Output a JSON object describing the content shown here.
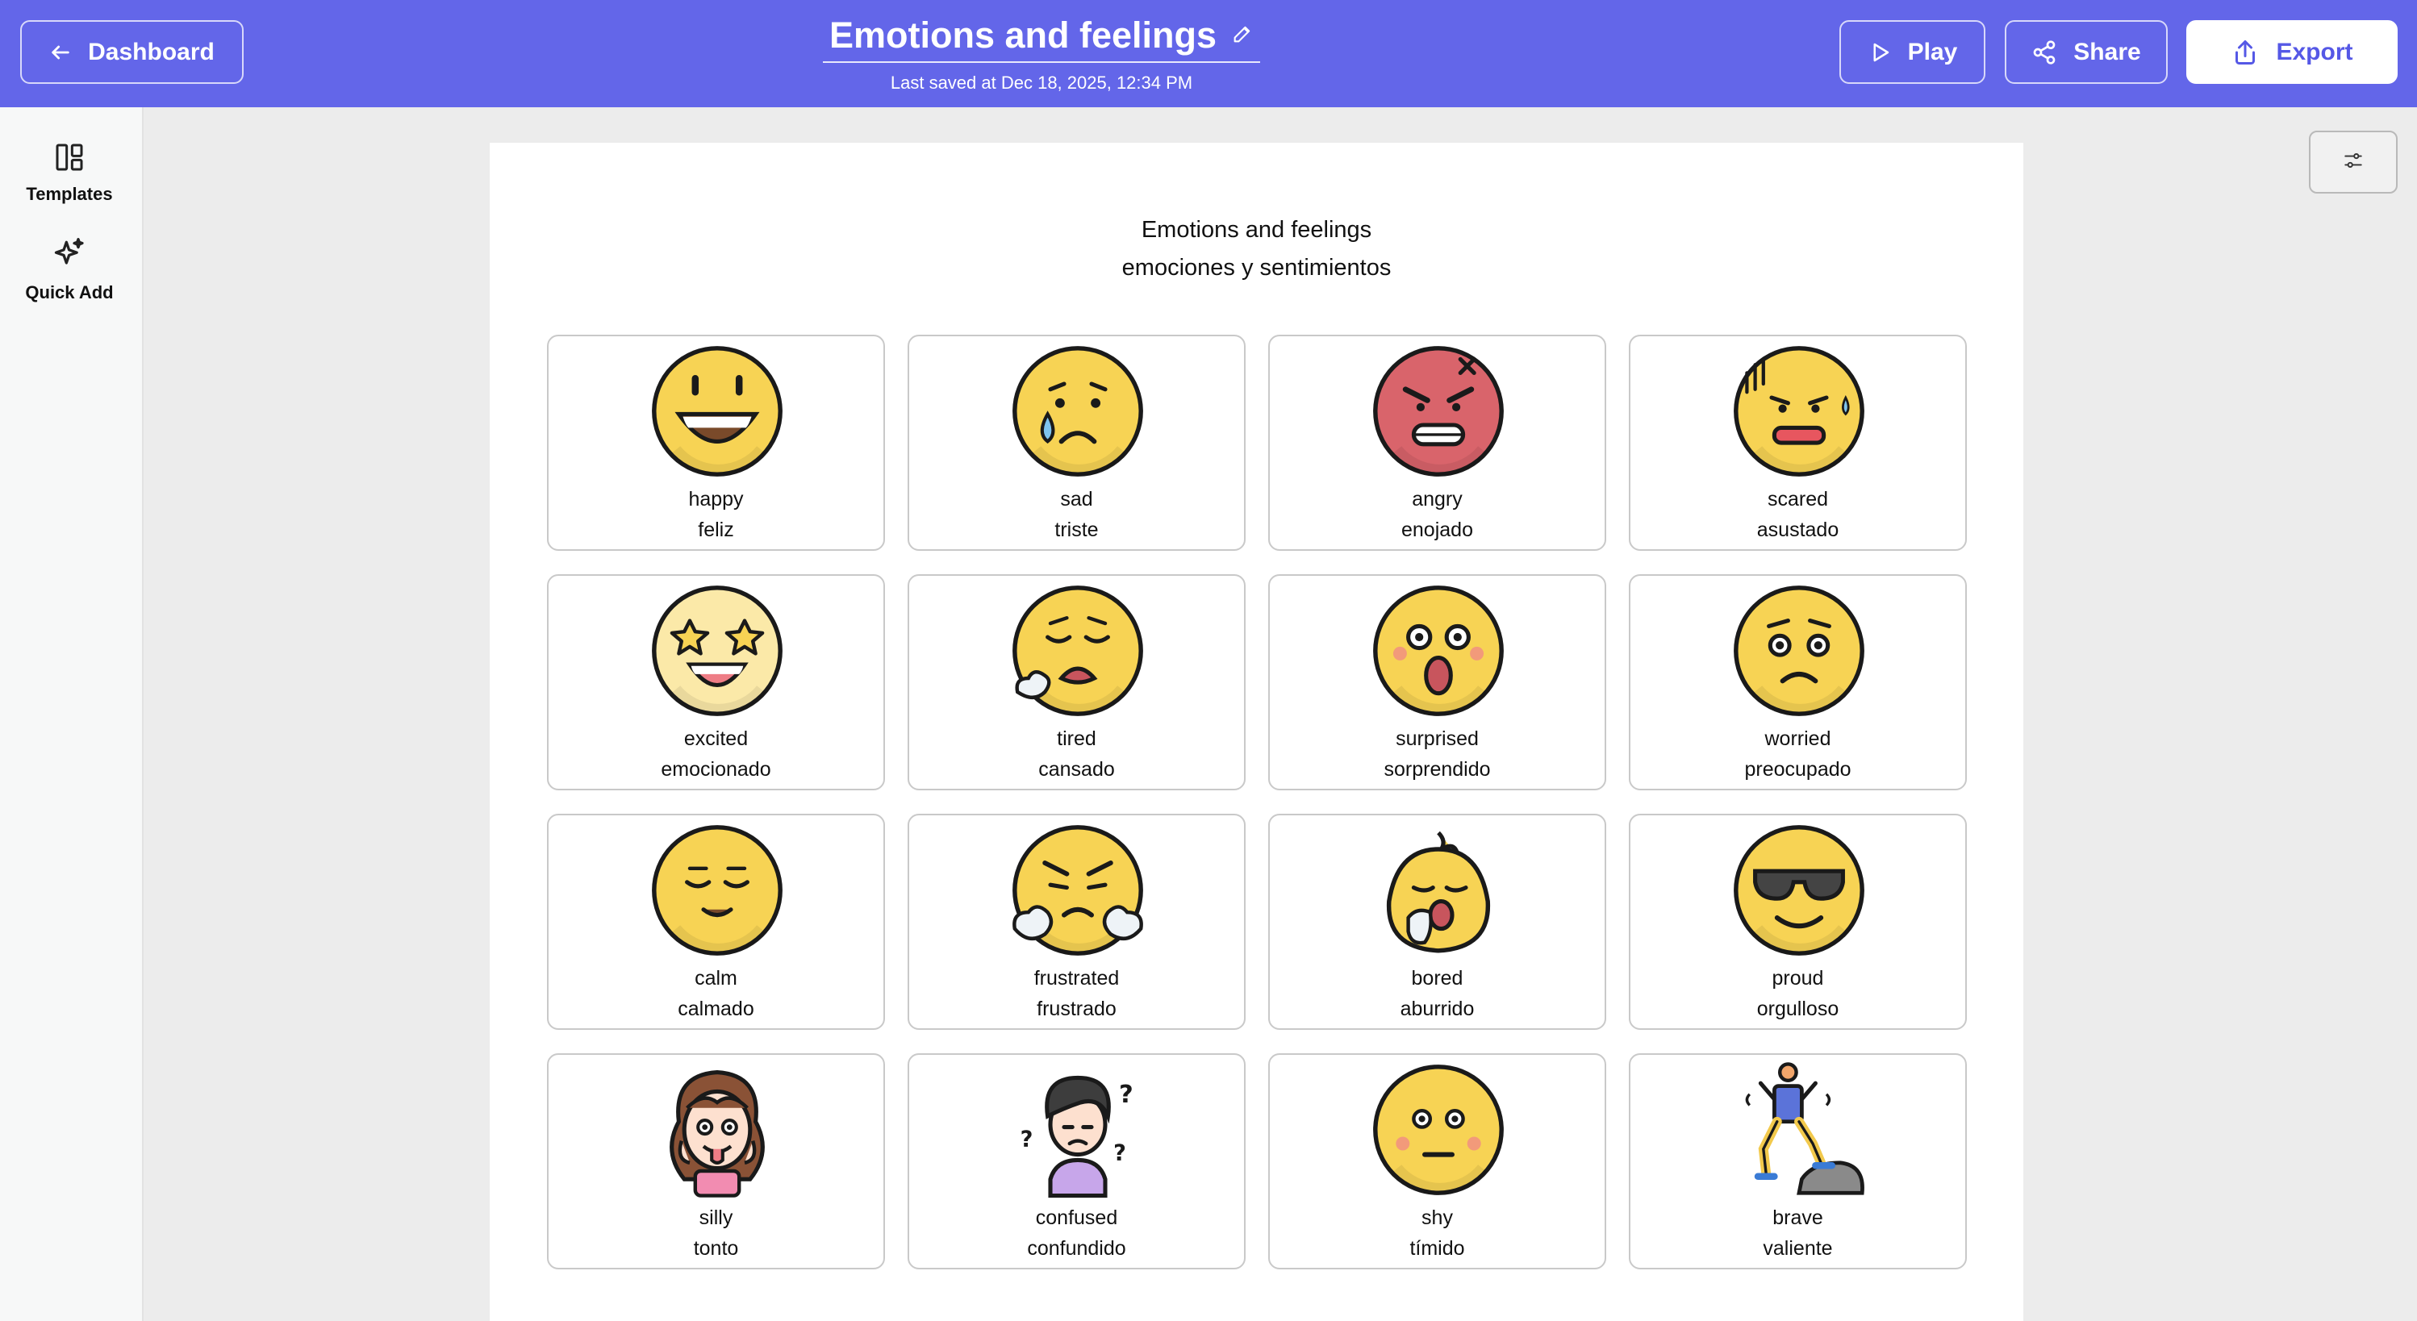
{
  "header": {
    "dashboard_label": "Dashboard",
    "title": "Emotions and feelings",
    "saved": "Last saved at Dec 18, 2025, 12:34 PM",
    "play_label": "Play",
    "share_label": "Share",
    "export_label": "Export",
    "color": "#6366e9"
  },
  "sidebar": {
    "items": [
      {
        "label": "Templates",
        "icon": "templates-icon"
      },
      {
        "label": "Quick Add",
        "icon": "sparkle-icon"
      }
    ]
  },
  "sheet": {
    "title_en": "Emotions and feelings",
    "title_es": "emociones y sentimientos"
  },
  "cards": [
    {
      "en": "happy",
      "es": "feliz",
      "icon": "happy-face-icon"
    },
    {
      "en": "sad",
      "es": "triste",
      "icon": "sad-face-icon"
    },
    {
      "en": "angry",
      "es": "enojado",
      "icon": "angry-face-icon"
    },
    {
      "en": "scared",
      "es": "asustado",
      "icon": "scared-face-icon"
    },
    {
      "en": "excited",
      "es": "emocionado",
      "icon": "star-eyes-face-icon"
    },
    {
      "en": "tired",
      "es": "cansado",
      "icon": "tired-face-icon"
    },
    {
      "en": "surprised",
      "es": "sorprendido",
      "icon": "surprised-face-icon"
    },
    {
      "en": "worried",
      "es": "preocupado",
      "icon": "worried-face-icon"
    },
    {
      "en": "calm",
      "es": "calmado",
      "icon": "calm-face-icon"
    },
    {
      "en": "frustrated",
      "es": "frustrado",
      "icon": "frustrated-face-icon"
    },
    {
      "en": "bored",
      "es": "aburrido",
      "icon": "bored-face-icon"
    },
    {
      "en": "proud",
      "es": "orgulloso",
      "icon": "sunglasses-face-icon"
    },
    {
      "en": "silly",
      "es": "tonto",
      "icon": "silly-girl-icon"
    },
    {
      "en": "confused",
      "es": "confundido",
      "icon": "confused-boy-icon"
    },
    {
      "en": "shy",
      "es": "tímido",
      "icon": "shy-face-icon"
    },
    {
      "en": "brave",
      "es": "valiente",
      "icon": "brave-person-icon"
    }
  ]
}
